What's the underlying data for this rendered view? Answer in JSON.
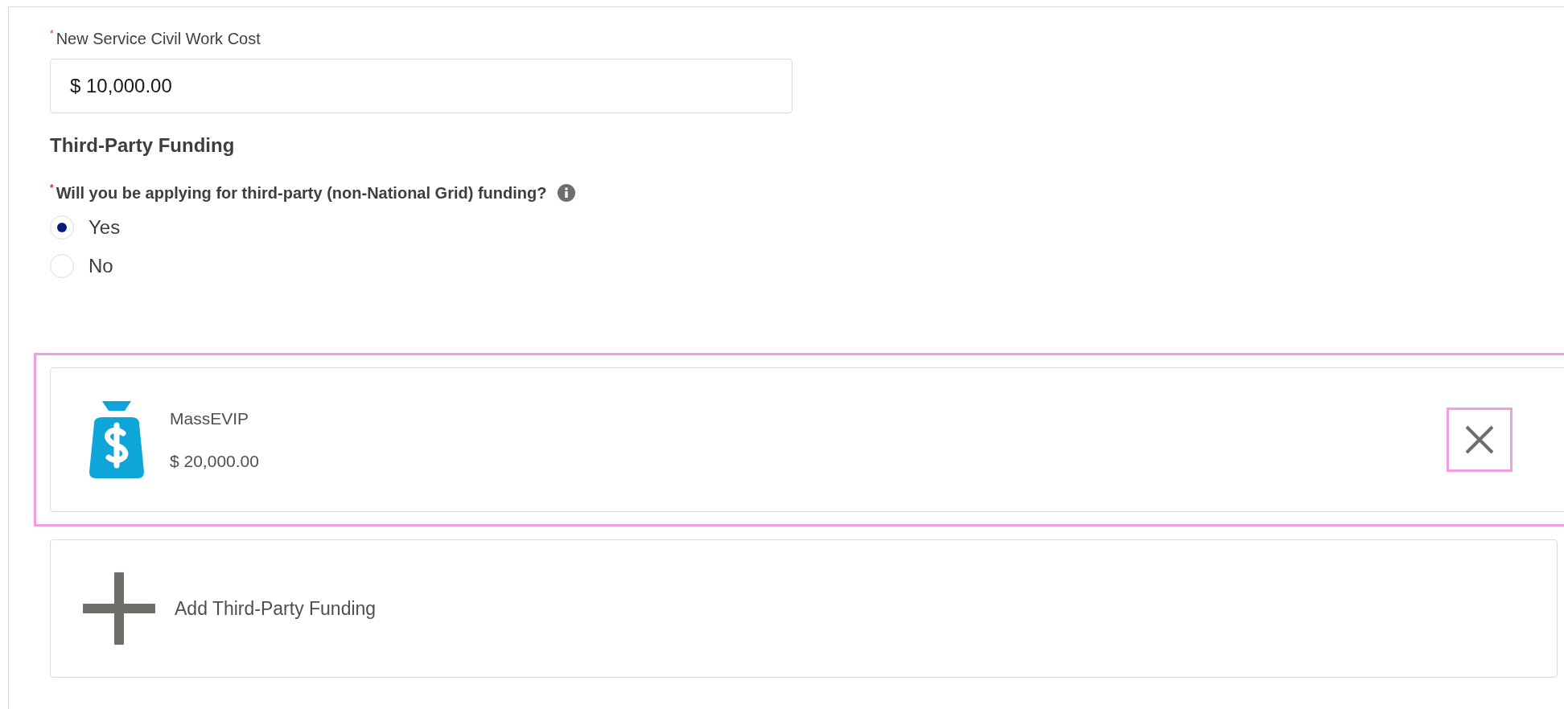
{
  "cost_field": {
    "label": "New Service Civil Work Cost",
    "marker": "*",
    "value": "$ 10,000.00"
  },
  "section_title": "Third-Party Funding",
  "question": {
    "label": "Will you be applying for third-party (non-National Grid) funding?",
    "marker": "*",
    "options": [
      {
        "label": "Yes",
        "selected": true
      },
      {
        "label": "No",
        "selected": false
      }
    ]
  },
  "funding_items": [
    {
      "name": "MassEVIP",
      "amount": "$ 20,000.00",
      "highlighted": true
    }
  ],
  "add_funding": {
    "label": "Add Third-Party Funding"
  }
}
